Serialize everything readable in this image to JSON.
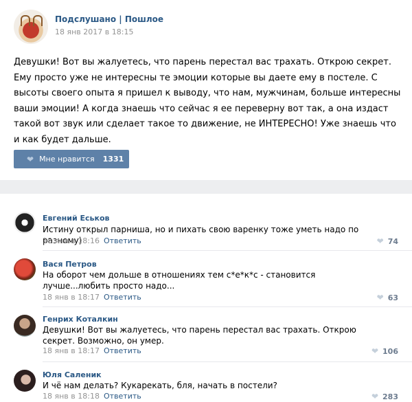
{
  "post": {
    "group_name": "Подслушано | Пошлое",
    "date": "18 янв 2017 в 18:15",
    "text": "Девушки! Вот вы жалуетесь, что парень перестал вас трахать. Открою секрет. Ему просто уже не интересны те эмоции которые вы даете ему в постеле. С высоты своего опыта я пришел к выводу, что нам, мужчинам, больше интересны ваши эмоции! А когда знаешь что сейчас я ее переверну вот так, а она издаст такой вот звук или сделает такое то движение, не ИНТЕРЕСНО! Уже знаешь что и как будет дальше.",
    "like_label": "Мне нравится",
    "like_count": "1331"
  },
  "reply_label": "Ответить",
  "comments": [
    {
      "name": "Евгений Еськов",
      "text": "Истину открыл парниша, но и пихать свою варенку тоже уметь надо по разному)",
      "date": "18 янв в 18:16",
      "likes": "74"
    },
    {
      "name": "Вася Петров",
      "text": "На оборот чем дольше в отношениях тем с*е*к*с - становится лучше...любить просто надо...",
      "date": "18 янв в 18:17",
      "likes": "63"
    },
    {
      "name": "Генрих Коталкин",
      "text": "Девушки! Вот вы жалуетесь, что парень перестал вас трахать. Открою секрет. Возможно, он умер.",
      "date": "18 янв в 18:17",
      "likes": "106"
    },
    {
      "name": "Юля Саленик",
      "text": "И чё нам делать? Кукарекать, бля, начать в постели?",
      "date": "18 янв в 18:18",
      "likes": "283"
    }
  ],
  "icons": {
    "like": "heart-icon"
  },
  "colors": {
    "link": "#2a5885",
    "button": "#5e81a8",
    "meta": "#939393",
    "separator": "#edeef0"
  }
}
